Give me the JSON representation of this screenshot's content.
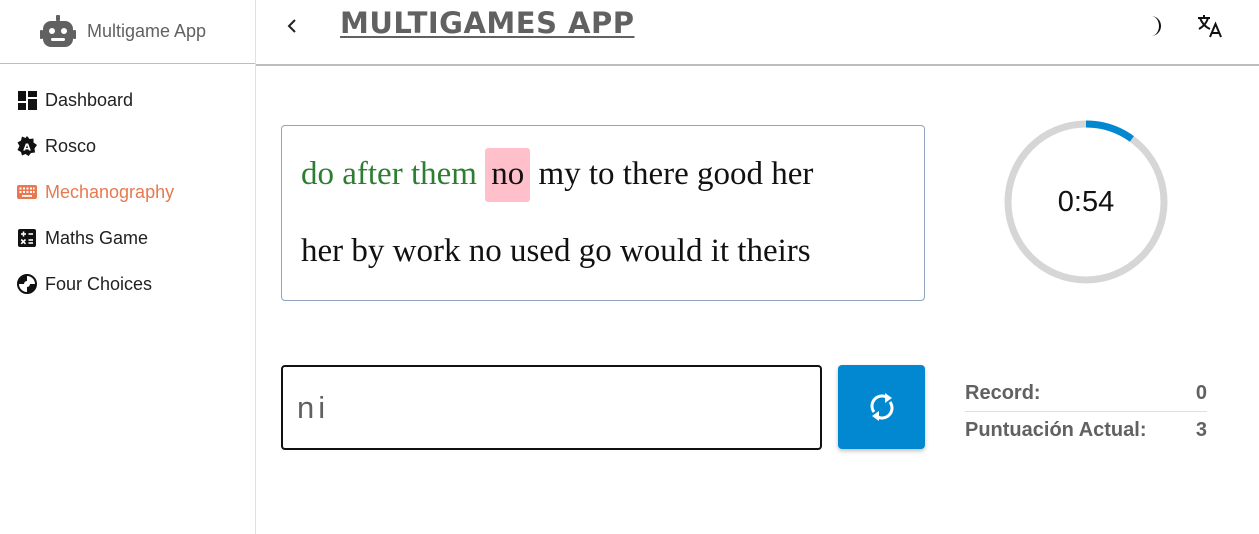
{
  "sidebar": {
    "brand": "Multigame App",
    "items": [
      {
        "label": "Dashboard",
        "icon": "dashboard-icon"
      },
      {
        "label": "Rosco",
        "icon": "alphabet-badge-icon"
      },
      {
        "label": "Mechanography",
        "icon": "keyboard-icon",
        "active": true
      },
      {
        "label": "Maths Game",
        "icon": "calculator-icon"
      },
      {
        "label": "Four Choices",
        "icon": "quiz-icon"
      }
    ]
  },
  "header": {
    "title": "MULTIGAMES APP",
    "theme_icon": "moon-icon",
    "translate_icon": "translate-icon"
  },
  "game": {
    "typed_words": "do after them",
    "current_word": "no",
    "line1_rest": "my to there good her",
    "line2": "her by work no used go would it theirs",
    "timer": "0:54",
    "timer_progress": 0.1,
    "input_value": "ni",
    "record_label": "Record:",
    "record_value": "0",
    "score_label": "Puntuación Actual:",
    "score_value": "3"
  },
  "colors": {
    "accent": "#e8784f",
    "primary_button": "#0288d1",
    "typed": "#2e7d32",
    "current_highlight": "#ffc0cb"
  }
}
